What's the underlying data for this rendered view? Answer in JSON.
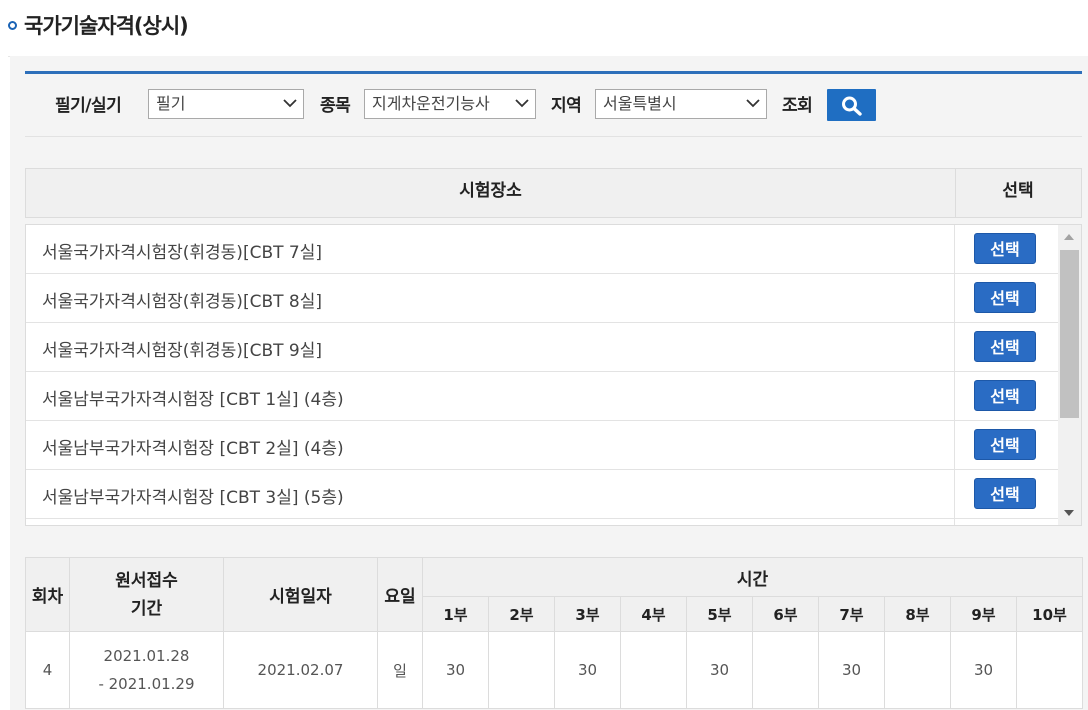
{
  "page": {
    "title": "국가기술자격(상시)"
  },
  "search": {
    "type_label": "필기/실기",
    "type_value": "필기",
    "item_label": "종목",
    "item_value": "지게차운전기능사",
    "region_label": "지역",
    "region_value": "서울특별시",
    "lookup_label": "조회"
  },
  "venue_table": {
    "headers": {
      "venue": "시험장소",
      "select": "선택"
    },
    "rows": [
      {
        "name": "서울국가자격시험장(휘경동)[CBT 7실]",
        "button": "선택"
      },
      {
        "name": "서울국가자격시험장(휘경동)[CBT 8실]",
        "button": "선택"
      },
      {
        "name": "서울국가자격시험장(휘경동)[CBT 9실]",
        "button": "선택"
      },
      {
        "name": "서울남부국가자격시험장 [CBT 1실] (4층)",
        "button": "선택"
      },
      {
        "name": "서울남부국가자격시험장 [CBT 2실] (4층)",
        "button": "선택"
      },
      {
        "name": "서울남부국가자격시험장 [CBT 3실] (5층)",
        "button": "선택"
      }
    ]
  },
  "schedule": {
    "headers": {
      "round": "회차",
      "apply_line1": "원서접수",
      "apply_line2": "기간",
      "exam_date": "시험일자",
      "weekday": "요일",
      "time": "시간",
      "sessions": [
        "1부",
        "2부",
        "3부",
        "4부",
        "5부",
        "6부",
        "7부",
        "8부",
        "9부",
        "10부"
      ]
    },
    "rows": [
      {
        "round": "4",
        "apply_start": "2021.01.28",
        "apply_end": "- 2021.01.29",
        "exam_date": "2021.02.07",
        "weekday": "일",
        "sessions": [
          "30",
          "",
          "30",
          "",
          "30",
          "",
          "30",
          "",
          "30",
          ""
        ]
      }
    ]
  }
}
